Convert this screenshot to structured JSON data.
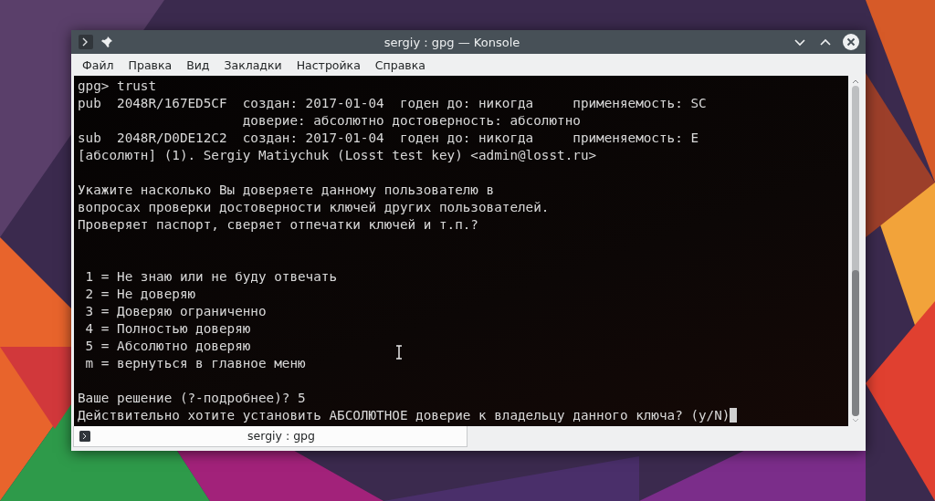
{
  "window": {
    "title": "sergiy : gpg — Konsole"
  },
  "menu": [
    "Файл",
    "Правка",
    "Вид",
    "Закладки",
    "Настройка",
    "Справка"
  ],
  "terminal": {
    "blocks": [
      [
        "gpg> trust",
        "pub  2048R/167ED5CF  создан: 2017-01-04  годен до: никогда     применяемость: SC",
        "                     доверие: абсолютно достоверность: абсолютно",
        "sub  2048R/D0DE12C2  создан: 2017-01-04  годен до: никогда     применяемость: E",
        "[абсолютн] (1). Sergiy Matiychuk (Losst test key) <admin@losst.ru>"
      ],
      [
        "Укажите насколько Вы доверяете данному пользователю в",
        "вопросах проверки достоверности ключей других пользователей.",
        "Проверяет паспорт, сверяет отпечатки ключей и т.п.?"
      ],
      [
        " 1 = Не знаю или не буду отвечать",
        " 2 = Не доверяю",
        " 3 = Доверяю ограниченно",
        " 4 = Полностью доверяю",
        " 5 = Абсолютно доверяю",
        " m = вернуться в главное меню"
      ],
      [
        "Ваше решение (?-подробнее)? 5",
        "Действительно хотите установить АБСОЛЮТНОЕ доверие к владельцу данного ключа? (y/N)"
      ]
    ]
  },
  "tabs": [
    {
      "label": "sergiy : gpg"
    }
  ]
}
